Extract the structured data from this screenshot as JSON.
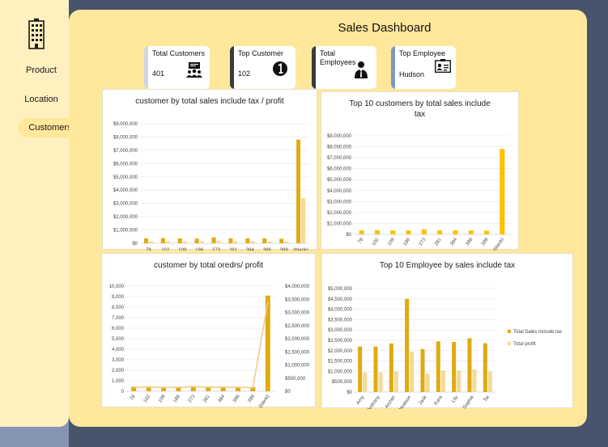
{
  "title": "Sales Dashboard",
  "nav": {
    "product": "Product",
    "location": "Location",
    "customers": "Customers"
  },
  "kpis": [
    {
      "label": "Total Customers",
      "value": "401",
      "icon": "people-chat-icon",
      "accent": "#cfd5e1"
    },
    {
      "label": "Top Customer",
      "value": "102",
      "icon": "number-one-icon",
      "accent": "#3a3a3a"
    },
    {
      "label": "Total Employees",
      "value": "",
      "icon": "businessman-icon",
      "accent": "#3a3a3a"
    },
    {
      "label": "Top Employee",
      "value": "Hudson",
      "icon": "id-card-icon",
      "accent": "#7d99bd"
    }
  ],
  "colors": {
    "primary": "#dfab10",
    "secondary": "#f7d894",
    "bright": "#ffc000",
    "line": "#f6c98b"
  },
  "chart_data": [
    {
      "type": "bar",
      "title": "customer by total sales include tax / profit",
      "categories": [
        "78",
        "102",
        "109",
        "186",
        "273",
        "281",
        "384",
        "398",
        "399",
        "(blank)"
      ],
      "series": [
        {
          "values": [
            370000,
            390000,
            365000,
            360000,
            450000,
            375000,
            375000,
            365000,
            340000,
            7800000
          ]
        },
        {
          "values": [
            150000,
            160000,
            150000,
            150000,
            180000,
            155000,
            155000,
            150000,
            140000,
            3400000
          ]
        }
      ],
      "yticks": [
        "$0",
        "$1,000,000",
        "$2,000,000",
        "$3,000,000",
        "$4,000,000",
        "$5,000,000",
        "$6,000,000",
        "$7,000,000",
        "$8,000,000",
        "$9,000,000"
      ],
      "ylim": [
        0,
        9000000
      ]
    },
    {
      "type": "bar",
      "title": "Top 10 customers by total sales include tax",
      "categories": [
        "78",
        "102",
        "109",
        "186",
        "273",
        "281",
        "384",
        "398",
        "399",
        "(blank)"
      ],
      "series": [
        {
          "values": [
            370000,
            390000,
            365000,
            360000,
            450000,
            375000,
            375000,
            365000,
            340000,
            7800000
          ]
        }
      ],
      "yticks": [
        "$0",
        "$1,000,000",
        "$2,000,000",
        "$3,000,000",
        "$4,000,000",
        "$5,000,000",
        "$6,000,000",
        "$7,000,000",
        "$8,000,000",
        "$9,000,000"
      ],
      "ylim": [
        0,
        9000000
      ]
    },
    {
      "type": "bar",
      "title": "customer by total oredrs/ profit",
      "categories": [
        "78",
        "102",
        "109",
        "186",
        "273",
        "281",
        "384",
        "398",
        "399",
        "(blank)"
      ],
      "series": [
        {
          "values": [
            430,
            410,
            410,
            400,
            440,
            410,
            410,
            400,
            390,
            9100
          ]
        },
        {
          "values": [
            150000,
            160000,
            150000,
            150000,
            180000,
            155000,
            155000,
            150000,
            140000,
            3400000
          ]
        }
      ],
      "yticks": [
        "0",
        "1,000",
        "2,000",
        "3,000",
        "4,000",
        "5,000",
        "6,000",
        "7,000",
        "8,000",
        "9,000",
        "10,000"
      ],
      "ylim": [
        0,
        10000
      ],
      "y2ticks": [
        "$0",
        "$500,000",
        "$1,000,000",
        "$1,500,000",
        "$2,000,000",
        "$2,500,000",
        "$3,000,000",
        "$3,500,000",
        "$4,000,000"
      ],
      "y2lim": [
        0,
        4000000
      ]
    },
    {
      "type": "bar",
      "title": "Top 10 Employee by sales include tax",
      "categories": [
        "Amy",
        "Anthony",
        "Archer",
        "Hudson",
        "Jack",
        "Kara",
        "Lily",
        "Sophia",
        "Tai"
      ],
      "series": [
        {
          "name": "Total Sales Include tax",
          "values": [
            2200000,
            2200000,
            2350000,
            4500000,
            2080000,
            2450000,
            2420000,
            2600000,
            2360000
          ]
        },
        {
          "name": "Total profit",
          "values": [
            950000,
            950000,
            1000000,
            1950000,
            900000,
            1050000,
            1050000,
            1100000,
            1000000
          ]
        }
      ],
      "yticks": [
        "$0",
        "$500,000",
        "$1,000,000",
        "$1,500,000",
        "$2,000,000",
        "$2,500,000",
        "$3,000,000",
        "$3,500,000",
        "$4,000,000",
        "$4,500,000",
        "$5,000,000"
      ],
      "ylim": [
        0,
        5000000
      ],
      "legend": "right"
    }
  ]
}
